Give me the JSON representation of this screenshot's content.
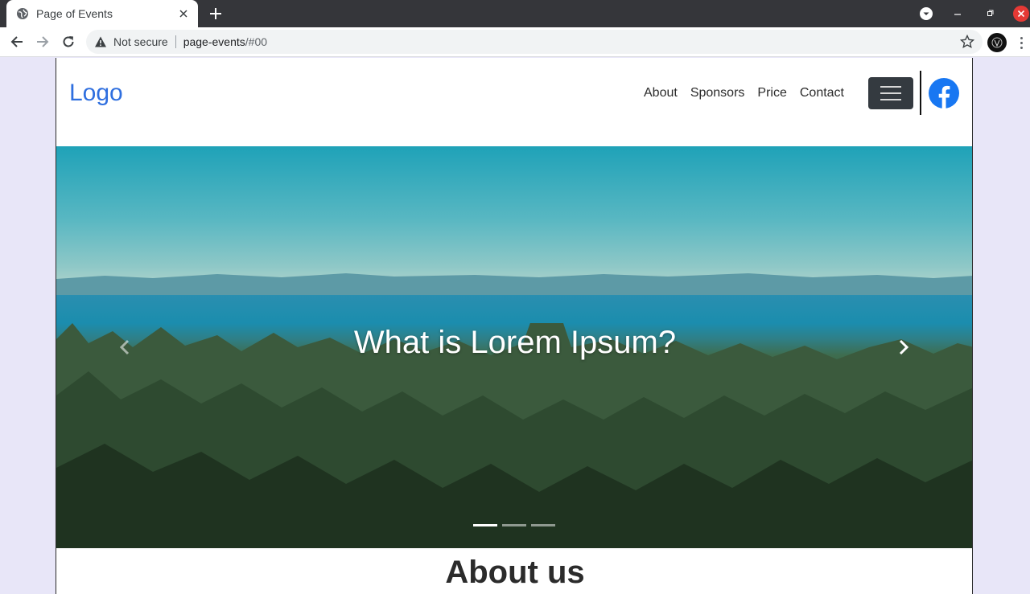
{
  "browser": {
    "tab_title": "Page of Events",
    "security_label": "Not secure",
    "url_host": "page-events",
    "url_path": "/#00"
  },
  "navbar": {
    "logo": "Logo",
    "links": [
      "About",
      "Sponsors",
      "Price",
      "Contact"
    ]
  },
  "hero": {
    "caption": "What is Lorem Ipsum?",
    "slides_total": 3,
    "active_slide": 1
  },
  "about": {
    "title": "About us"
  },
  "colors": {
    "logo": "#2f6fdf",
    "toggler": "#343a40",
    "facebook": "#1877f2",
    "body_bg": "#e8e6f8",
    "close_window": "#e53935"
  },
  "icons": [
    "globe-icon",
    "close-icon",
    "plus-icon",
    "back-icon",
    "forward-icon",
    "reload-icon",
    "warning-icon",
    "star-icon",
    "facebook-icon",
    "chevron-left-icon",
    "chevron-right-icon",
    "hamburger-icon"
  ]
}
